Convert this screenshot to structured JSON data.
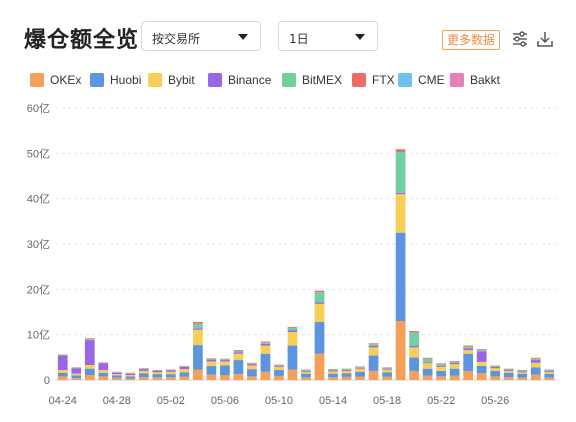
{
  "header": {
    "title": "爆仓额全览",
    "exchange_select": "按交易所",
    "interval_select": "1日",
    "more_data_label": "更多数据"
  },
  "icons": {
    "settings": "sliders-icon",
    "download": "download-icon"
  },
  "colors": {
    "OKEx": "#f5a05a",
    "Huobi": "#5b95e0",
    "Bybit": "#f8cf55",
    "Binance": "#9966e6",
    "BitMEX": "#72cfa0",
    "FTX": "#ec6c6c",
    "CME": "#6cc3e8",
    "Bakkt": "#e57fbd"
  },
  "chart_data": {
    "type": "bar",
    "stacked": true,
    "ylim": [
      0,
      60
    ],
    "yticks": [
      "0",
      "10亿",
      "20亿",
      "30亿",
      "40亿",
      "50亿",
      "60亿"
    ],
    "ytick_values": [
      0,
      10,
      20,
      30,
      40,
      50,
      60
    ],
    "grid": true,
    "legend_position": "top",
    "categories": [
      "04-24",
      "04-25",
      "04-26",
      "04-27",
      "04-28",
      "04-29",
      "04-30",
      "05-01",
      "05-02",
      "05-03",
      "05-04",
      "05-05",
      "05-06",
      "05-07",
      "05-08",
      "05-09",
      "05-10",
      "05-11",
      "05-12",
      "05-13",
      "05-14",
      "05-15",
      "05-16",
      "05-17",
      "05-18",
      "05-19",
      "05-20",
      "05-21",
      "05-22",
      "05-23",
      "05-24",
      "05-25",
      "05-26",
      "05-27",
      "05-28",
      "05-29",
      "05-30"
    ],
    "xticks": [
      "04-24",
      "04-28",
      "05-02",
      "05-06",
      "05-10",
      "05-14",
      "05-18",
      "05-22",
      "05-26"
    ],
    "series": [
      {
        "name": "OKEx",
        "values": [
          0.8,
          0.4,
          1.1,
          0.8,
          0.5,
          0.3,
          0.6,
          0.6,
          0.6,
          0.7,
          2.3,
          1.2,
          1.1,
          1.3,
          0.8,
          1.8,
          0.9,
          2.3,
          0.6,
          5.8,
          0.6,
          0.7,
          0.7,
          2.0,
          0.7,
          13.0,
          2.0,
          1.0,
          0.8,
          1.0,
          2.0,
          1.5,
          0.8,
          0.6,
          0.5,
          1.2,
          0.5
        ]
      },
      {
        "name": "Huobi",
        "values": [
          0.8,
          0.6,
          1.4,
          0.8,
          0.5,
          0.5,
          0.9,
          0.7,
          0.7,
          1.0,
          5.4,
          1.9,
          2.1,
          3.1,
          1.6,
          4.0,
          1.3,
          5.3,
          0.8,
          7.0,
          0.8,
          0.8,
          1.1,
          3.4,
          1.0,
          19.5,
          3.0,
          1.5,
          1.2,
          1.5,
          3.8,
          1.6,
          1.2,
          1.0,
          0.9,
          1.6,
          0.9
        ]
      },
      {
        "name": "Bybit",
        "values": [
          0.6,
          0.4,
          0.8,
          0.6,
          0.3,
          0.3,
          0.5,
          0.4,
          0.5,
          0.7,
          3.4,
          1.0,
          0.9,
          1.4,
          0.8,
          1.8,
          0.7,
          3.0,
          0.4,
          4.0,
          0.5,
          0.5,
          0.7,
          1.8,
          0.6,
          8.5,
          2.2,
          1.2,
          0.9,
          1.0,
          0.8,
          0.9,
          0.6,
          0.4,
          0.3,
          1.0,
          0.4
        ]
      },
      {
        "name": "Binance",
        "values": [
          3.2,
          1.2,
          5.5,
          1.5,
          0.3,
          0.3,
          0.4,
          0.3,
          0.3,
          0.5,
          0.3,
          0.4,
          0.3,
          0.3,
          0.3,
          0.4,
          0.2,
          0.4,
          0.2,
          0.3,
          0.2,
          0.2,
          0.2,
          0.3,
          0.2,
          0.3,
          0.3,
          0.2,
          0.2,
          0.3,
          0.4,
          2.3,
          0.3,
          0.2,
          0.2,
          0.6,
          0.2
        ]
      },
      {
        "name": "BitMEX",
        "values": [
          0.1,
          0.1,
          0.2,
          0.1,
          0.1,
          0.1,
          0.1,
          0.1,
          0.1,
          0.1,
          1.0,
          0.2,
          0.2,
          0.3,
          0.2,
          0.3,
          0.2,
          0.5,
          0.2,
          2.3,
          0.2,
          0.2,
          0.2,
          0.4,
          0.2,
          9.0,
          3.0,
          0.8,
          0.5,
          0.3,
          0.4,
          0.3,
          0.2,
          0.2,
          0.2,
          0.3,
          0.2
        ]
      },
      {
        "name": "FTX",
        "values": [
          0.1,
          0.1,
          0.2,
          0.1,
          0.1,
          0.1,
          0.1,
          0.1,
          0.1,
          0.1,
          0.4,
          0.1,
          0.1,
          0.2,
          0.1,
          0.2,
          0.1,
          0.2,
          0.1,
          0.3,
          0.1,
          0.1,
          0.1,
          0.2,
          0.1,
          0.6,
          0.3,
          0.2,
          0.1,
          0.1,
          0.2,
          0.2,
          0.1,
          0.1,
          0.1,
          0.2,
          0.1
        ]
      },
      {
        "name": "CME",
        "values": [
          0,
          0,
          0,
          0,
          0,
          0,
          0,
          0,
          0,
          0,
          0,
          0,
          0,
          0,
          0,
          0,
          0,
          0,
          0,
          0,
          0,
          0,
          0,
          0,
          0,
          0,
          0,
          0,
          0,
          0,
          0,
          0,
          0,
          0,
          0,
          0,
          0
        ]
      },
      {
        "name": "Bakkt",
        "values": [
          0,
          0,
          0,
          0,
          0,
          0,
          0,
          0,
          0,
          0,
          0,
          0,
          0,
          0,
          0,
          0,
          0,
          0,
          0,
          0,
          0,
          0,
          0,
          0,
          0,
          0,
          0,
          0,
          0,
          0,
          0,
          0,
          0,
          0,
          0,
          0,
          0
        ]
      }
    ]
  }
}
